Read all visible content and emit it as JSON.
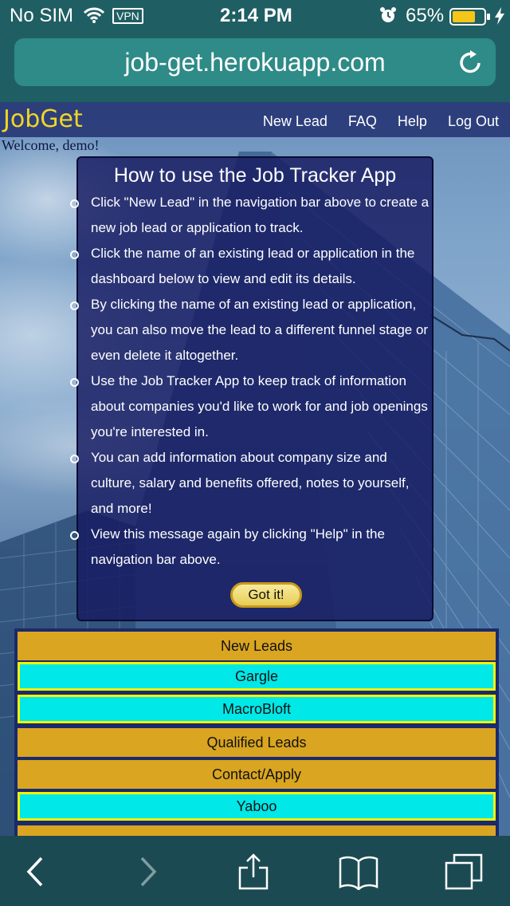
{
  "status_bar": {
    "carrier": "No SIM",
    "vpn": "VPN",
    "time": "2:14 PM",
    "battery_percent": "65%"
  },
  "browser": {
    "url": "job-get.herokuapp.com"
  },
  "nav": {
    "brand": "JobGet",
    "links": [
      "New Lead",
      "FAQ",
      "Help",
      "Log Out"
    ]
  },
  "welcome": "Welcome, demo!",
  "help": {
    "title": "How to use the Job Tracker App",
    "items": [
      "Click \"New Lead\" in the navigation bar above to create a new job lead or application to track.",
      "Click the name of an existing lead or application in the dashboard below to view and edit its details.",
      "By clicking the name of an existing lead or application, you can also move the lead to a different funnel stage or even delete it altogether.",
      "Use the Job Tracker App to keep track of information about companies you'd like to work for and job openings you're interested in.",
      "You can add information about company size and culture, salary and benefits offered, notes to yourself, and more!",
      "View this message again by clicking \"Help\" in the navigation bar above."
    ],
    "button": "Got it!"
  },
  "dashboard": {
    "rows": [
      {
        "label": "New Leads",
        "kind": "stage"
      },
      {
        "label": "Gargle",
        "kind": "lead"
      },
      {
        "label": "MacroBloft",
        "kind": "lead"
      },
      {
        "label": "Qualified Leads",
        "kind": "stage"
      },
      {
        "label": "Contact/Apply",
        "kind": "stage"
      },
      {
        "label": "Yaboo",
        "kind": "lead"
      },
      {
        "label": "",
        "kind": "stage"
      }
    ]
  },
  "colors": {
    "stage_row": "#daa520",
    "lead_row": "#00e8e8",
    "lead_border": "#f2f200",
    "brand": "#f2d624"
  },
  "icons": {
    "toolbar": [
      "back-icon",
      "forward-icon",
      "share-icon",
      "bookmarks-icon",
      "tabs-icon"
    ]
  }
}
